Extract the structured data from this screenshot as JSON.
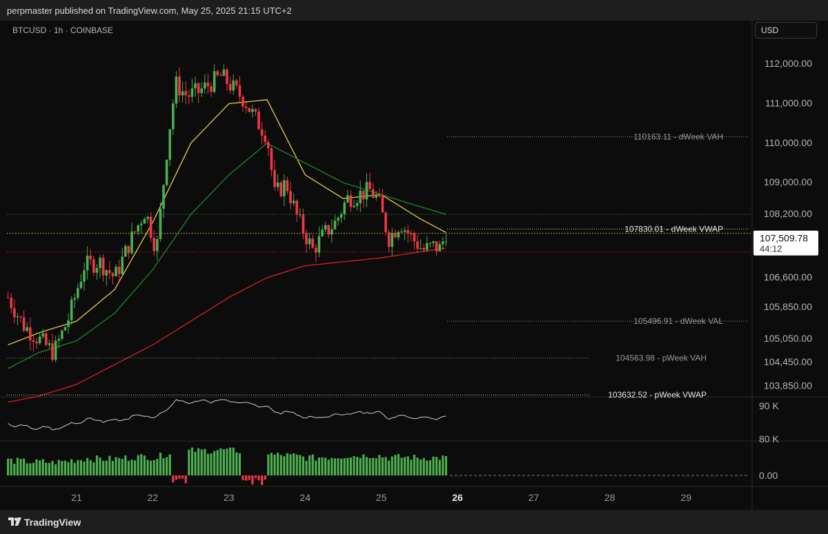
{
  "header": {
    "text": "perpmaster published on TradingView.com, May 25, 2025 21:15 UTC+2"
  },
  "symbol_label": "BTCUSD · 1h · COINBASE",
  "currency_button": "USD",
  "footer": {
    "brand": "TradingView",
    "logo_icon": "tradingview-logo-icon"
  },
  "colors": {
    "background": "#0c0c0c",
    "up": "#4caf50",
    "down": "#f23645",
    "ema_fast": "#e6d04a",
    "ema_mid": "#1f8a2c",
    "ema_slow": "#e01f24"
  },
  "chart_data": [
    {
      "type": "candlestick",
      "instrument": "BTCUSD",
      "interval": "1h",
      "exchange": "COINBASE",
      "x_ticks": [
        "21",
        "22",
        "23",
        "24",
        "25",
        "26",
        "27",
        "28",
        "29"
      ],
      "x_tick_days": [
        21,
        22,
        23,
        24,
        25,
        26,
        27,
        28,
        29
      ],
      "xlim_days": [
        20.1,
        30.0
      ],
      "y_ticks": [
        "112,000.00",
        "111,000.00",
        "110,000.00",
        "109,000.00",
        "108,200.00",
        "106,600.00",
        "105,850.00",
        "105,050.00",
        "104,450.00",
        "103,850.00"
      ],
      "y_tick_values": [
        112000,
        111000,
        110000,
        109000,
        108200,
        106600,
        105850,
        105050,
        104450,
        103850
      ],
      "ylim": [
        103600,
        113100
      ],
      "last_price": {
        "label": "107,509.78",
        "value": 107509.78,
        "countdown": "44:12"
      },
      "levels": [
        {
          "label": "110163.11 - dWeek VAH",
          "value": 110163.11
        },
        {
          "label": "107830.01 - dWeek VWAP",
          "value": 107830.01
        },
        {
          "label": "105496.91 - dWeek VAL",
          "value": 105496.91
        },
        {
          "label": "104563.98 - pWeek VAH",
          "value": 104563.98
        },
        {
          "label": "103632.52 - pWeek VWAP",
          "value": 103632.52
        }
      ],
      "horizontal_lines": [
        {
          "name": "green-dotted-line",
          "value": 108200,
          "color": "#1f8a2c"
        },
        {
          "name": "yellow-dotted-line",
          "value": 107720,
          "color": "#e6d04a"
        },
        {
          "name": "red-dotted-line",
          "value": 107250,
          "color": "#e01f24"
        }
      ],
      "price_path_keypoints": {
        "days": [
          20.1,
          20.3,
          20.5,
          20.7,
          20.9,
          21.1,
          21.3,
          21.5,
          21.7,
          21.9,
          22.05,
          22.2,
          22.3,
          22.45,
          22.6,
          22.75,
          22.9,
          23.05,
          23.2,
          23.35,
          23.5,
          23.6,
          23.75,
          23.9,
          24.1,
          24.25,
          24.4,
          24.55,
          24.7,
          24.85,
          24.95,
          25.1,
          25.25,
          25.4,
          25.55,
          25.7,
          25.8,
          25.85
        ],
        "prices": [
          106100,
          105400,
          105050,
          104700,
          105600,
          106900,
          107000,
          106600,
          107500,
          108300,
          107300,
          110100,
          111500,
          111200,
          111300,
          111500,
          111700,
          111400,
          111100,
          110600,
          110200,
          108700,
          109000,
          108100,
          107300,
          107700,
          108000,
          108600,
          108700,
          108800,
          108600,
          107600,
          108000,
          107600,
          107300,
          107400,
          107300,
          107509.78
        ]
      },
      "ema_keypoints": {
        "days": [
          20.1,
          20.5,
          21.0,
          21.5,
          22.0,
          22.5,
          23.0,
          23.5,
          24.0,
          24.5,
          25.0,
          25.5,
          25.85
        ],
        "fast": [
          104900,
          105200,
          105500,
          106300,
          108000,
          110000,
          111000,
          111100,
          109200,
          108600,
          108700,
          108100,
          107740
        ],
        "mid": [
          104300,
          104700,
          105000,
          105700,
          106800,
          108200,
          109200,
          110000,
          109500,
          109000,
          108700,
          108400,
          108200
        ],
        "slow": [
          103450,
          103600,
          103900,
          104400,
          104900,
          105500,
          106100,
          106600,
          106900,
          107000,
          107100,
          107250,
          107350
        ]
      },
      "volume_axis": {
        "ticks": [
          "90 K",
          "80 K"
        ],
        "tick_values": [
          90000,
          80000
        ]
      },
      "oscillator_axis": {
        "ticks": [
          "0.00"
        ],
        "tick_values": [
          0
        ]
      }
    }
  ]
}
